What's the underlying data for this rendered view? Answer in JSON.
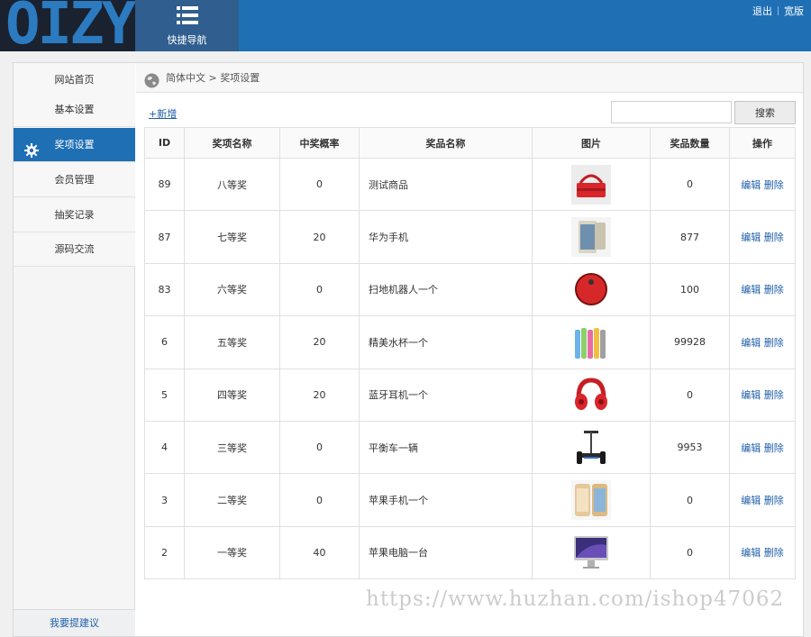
{
  "header": {
    "logo_text": "OIZY",
    "quick_nav_label": "快捷导航",
    "logout_label": "退出",
    "wide_label": "宽版",
    "accent_color": "#1f6fb5"
  },
  "sidebar": {
    "items": [
      {
        "label": "网站首页"
      },
      {
        "label": "基本设置"
      },
      {
        "label": "奖项设置"
      },
      {
        "label": "会员管理"
      },
      {
        "label": "抽奖记录"
      },
      {
        "label": "源码交流"
      }
    ],
    "active_index": 2,
    "suggest_label": "我要提建议"
  },
  "breadcrumb": {
    "text": "简体中文 > 奖项设置"
  },
  "toolbar": {
    "add_label": "+新增",
    "search_value": "",
    "search_button_label": "搜索"
  },
  "table": {
    "headers": [
      "ID",
      "奖项名称",
      "中奖概率",
      "奖品名称",
      "图片",
      "奖品数量",
      "操作"
    ],
    "rows": [
      {
        "id": "89",
        "level": "八等奖",
        "probability": "0",
        "prize": "测试商品",
        "image_icon": "red-bag-product-image",
        "quantity": "0"
      },
      {
        "id": "87",
        "level": "七等奖",
        "probability": "20",
        "prize": "华为手机",
        "image_icon": "huawei-phone-product-image",
        "quantity": "877"
      },
      {
        "id": "83",
        "level": "六等奖",
        "probability": "0",
        "prize": "扫地机器人一个",
        "image_icon": "robot-vacuum-product-image",
        "quantity": "100"
      },
      {
        "id": "6",
        "level": "五等奖",
        "probability": "20",
        "prize": "精美水杯一个",
        "image_icon": "water-bottles-product-image",
        "quantity": "99928"
      },
      {
        "id": "5",
        "level": "四等奖",
        "probability": "20",
        "prize": "蓝牙耳机一个",
        "image_icon": "headphones-product-image",
        "quantity": "0"
      },
      {
        "id": "4",
        "level": "三等奖",
        "probability": "0",
        "prize": "平衡车一辆",
        "image_icon": "balance-scooter-product-image",
        "quantity": "9953"
      },
      {
        "id": "3",
        "level": "二等奖",
        "probability": "0",
        "prize": "苹果手机一个",
        "image_icon": "iphone-product-image",
        "quantity": "0"
      },
      {
        "id": "2",
        "level": "一等奖",
        "probability": "40",
        "prize": "苹果电脑一台",
        "image_icon": "imac-product-image",
        "quantity": "0"
      }
    ],
    "edit_label": "编辑",
    "delete_label": "删除"
  },
  "watermark": "https://www.huzhan.com/ishop47062"
}
